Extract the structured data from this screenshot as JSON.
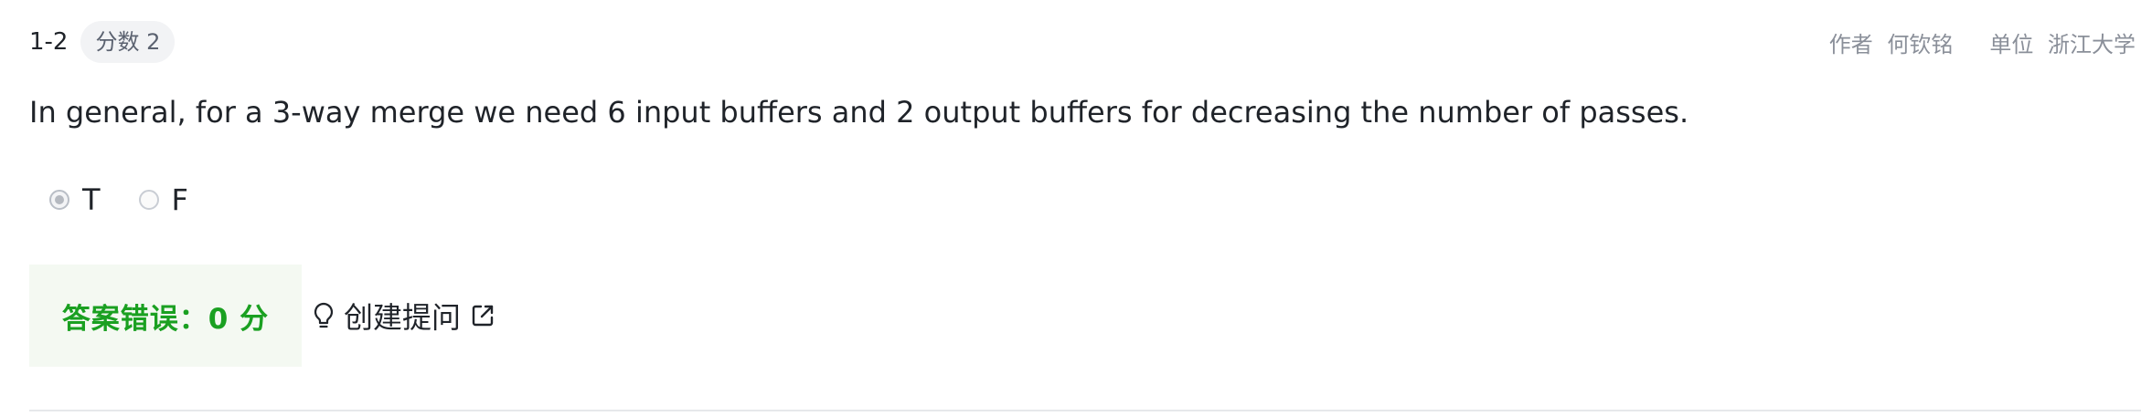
{
  "question": {
    "number": "1-2",
    "score_badge": "分数 2",
    "author_label": "作者",
    "author_name": "何钦铭",
    "unit_label": "单位",
    "unit_name": "浙江大学",
    "text": "In general, for a 3-way merge we need 6 input buffers and 2 output buffers for decreasing the number of passes.",
    "options": [
      {
        "label": "T",
        "selected": true
      },
      {
        "label": "F",
        "selected": false
      }
    ]
  },
  "result": {
    "text": "答案错误：0 分",
    "color": "#1aa021"
  },
  "ask": {
    "label": "创建提问",
    "icon": "lightbulb-icon",
    "external_icon": "external-link-icon"
  }
}
